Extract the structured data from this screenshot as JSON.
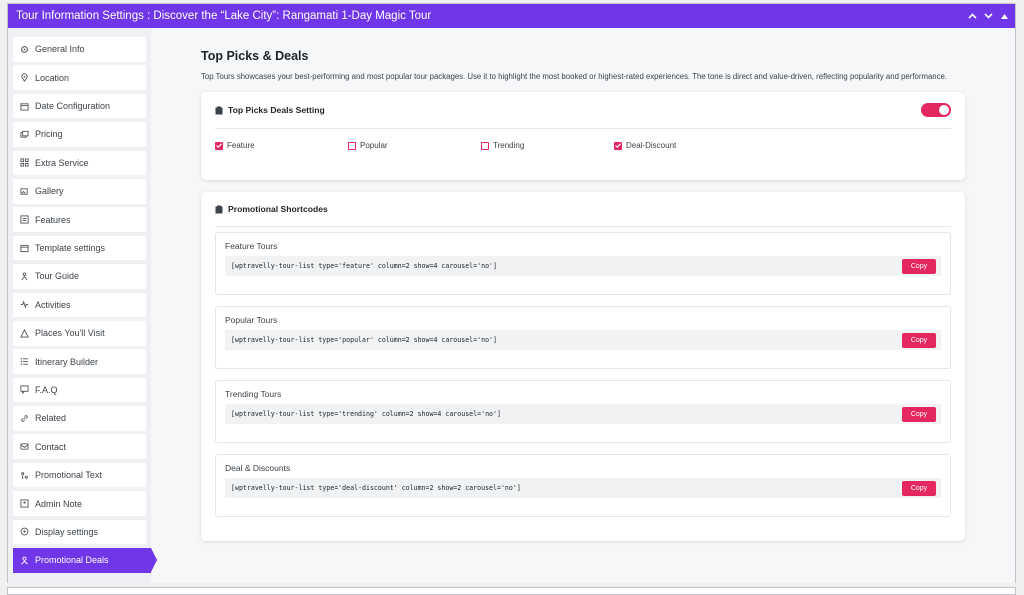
{
  "titlebar": {
    "title": "Tour Information Settings : Discover the “Lake City”: Rangamati 1-Day Magic Tour",
    "controls": [
      "chevron-up-icon",
      "chevron-down-icon",
      "triangle-up-icon"
    ]
  },
  "sidebar": {
    "items": [
      {
        "label": "General Info",
        "icon": "gear-icon"
      },
      {
        "label": "Location",
        "icon": "pin-icon"
      },
      {
        "label": "Date Configuration",
        "icon": "calendar-icon"
      },
      {
        "label": "Pricing",
        "icon": "cards-icon"
      },
      {
        "label": "Extra Service",
        "icon": "grid-icon"
      },
      {
        "label": "Gallery",
        "icon": "images-icon"
      },
      {
        "label": "Features",
        "icon": "list-icon"
      },
      {
        "label": "Template settings",
        "icon": "window-icon"
      },
      {
        "label": "Tour Guide",
        "icon": "person-icon"
      },
      {
        "label": "Activities",
        "icon": "activity-icon"
      },
      {
        "label": "Places You'll Visit",
        "icon": "places-icon"
      },
      {
        "label": "Itinerary Builder",
        "icon": "bullets-icon"
      },
      {
        "label": "F.A.Q",
        "icon": "faq-icon"
      },
      {
        "label": "Related",
        "icon": "link-icon"
      },
      {
        "label": "Contact",
        "icon": "mail-icon"
      },
      {
        "label": "Promotional Text",
        "icon": "tags-icon"
      },
      {
        "label": "Admin Note",
        "icon": "note-icon"
      },
      {
        "label": "Display settings",
        "icon": "display-icon"
      },
      {
        "label": "Promotional Deals",
        "icon": "deals-icon",
        "active": true
      }
    ]
  },
  "main": {
    "title": "Top Picks & Deals",
    "description": "Top Tours showcases your best-performing and most popular tour packages. Use it to highlight the most booked or highest-rated experiences. The tone is direct and value-driven, reflecting popularity and performance.",
    "settings_card": {
      "title": "Top Picks Deals Setting",
      "toggle_on": true,
      "options": [
        {
          "label": "Feature",
          "checked": true
        },
        {
          "label": "Popular",
          "checked": false
        },
        {
          "label": "Trending",
          "checked": false
        },
        {
          "label": "Deal-Discount",
          "checked": true
        }
      ]
    },
    "shortcodes_card": {
      "title": "Promotional Shortcodes",
      "copy_label": "Copy",
      "items": [
        {
          "title": "Feature Tours",
          "code": "[wptravelly-tour-list type='feature' column=2 show=4 carousel='no']"
        },
        {
          "title": "Popular Tours",
          "code": "[wptravelly-tour-list type='popular' column=2 show=4 carousel='no']"
        },
        {
          "title": "Trending Tours",
          "code": "[wptravelly-tour-list type='trending' column=2 show=4 carousel='no']"
        },
        {
          "title": "Deal & Discounts",
          "code": "[wptravelly-tour-list type='deal-discount' column=2 show=2 carousel='no']"
        }
      ]
    }
  },
  "colors": {
    "accent": "#6f37e7",
    "pink": "#e4275f"
  }
}
